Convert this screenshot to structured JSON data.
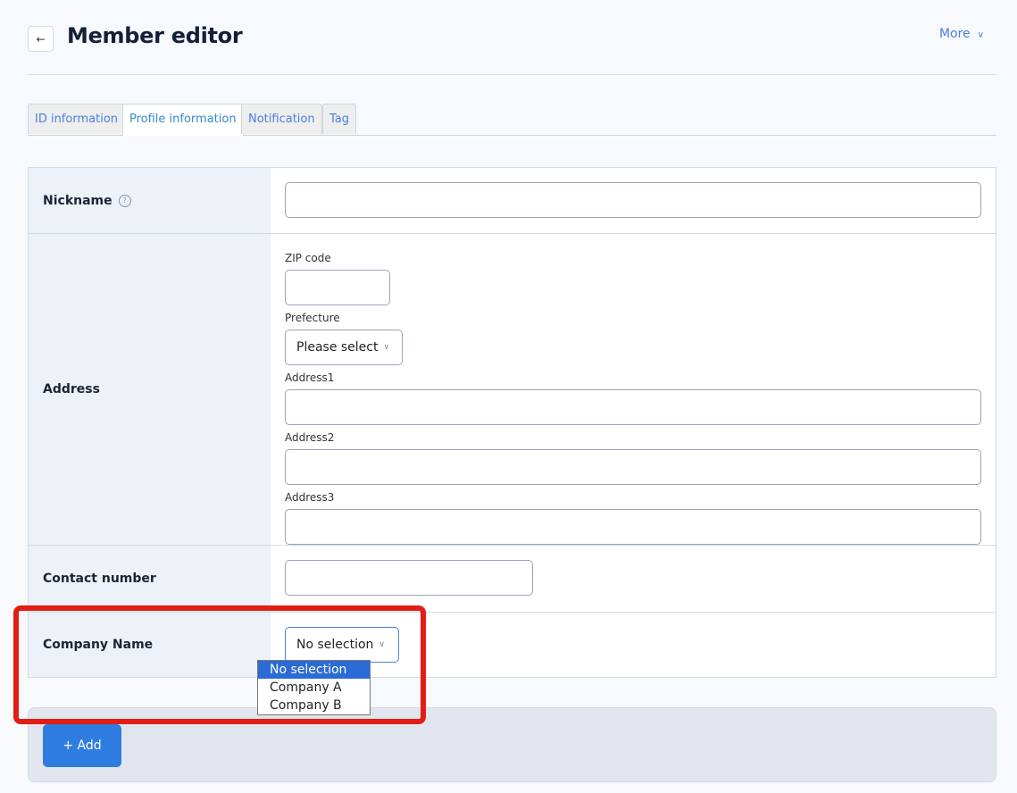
{
  "header": {
    "title": "Member editor",
    "more_label": "More",
    "back_icon": "arrow-left-icon"
  },
  "tabs": [
    {
      "label": "ID information",
      "active": false
    },
    {
      "label": "Profile information",
      "active": true
    },
    {
      "label": "Notification",
      "active": false
    },
    {
      "label": "Tag",
      "active": false
    }
  ],
  "form": {
    "nickname": {
      "label": "Nickname",
      "value": ""
    },
    "address": {
      "label": "Address",
      "zip_label": "ZIP code",
      "prefecture_label": "Prefecture",
      "prefecture_value": "Please select",
      "address1_label": "Address1",
      "address2_label": "Address2",
      "address3_label": "Address3"
    },
    "contact": {
      "label": "Contact number",
      "value": ""
    },
    "company": {
      "label": "Company Name",
      "value": "No selection",
      "options": [
        "No selection",
        "Company A",
        "Company B"
      ]
    }
  },
  "footer": {
    "add_label": "+ Add"
  },
  "colors": {
    "accent": "#2f7de1",
    "highlight": "#e31c15"
  }
}
